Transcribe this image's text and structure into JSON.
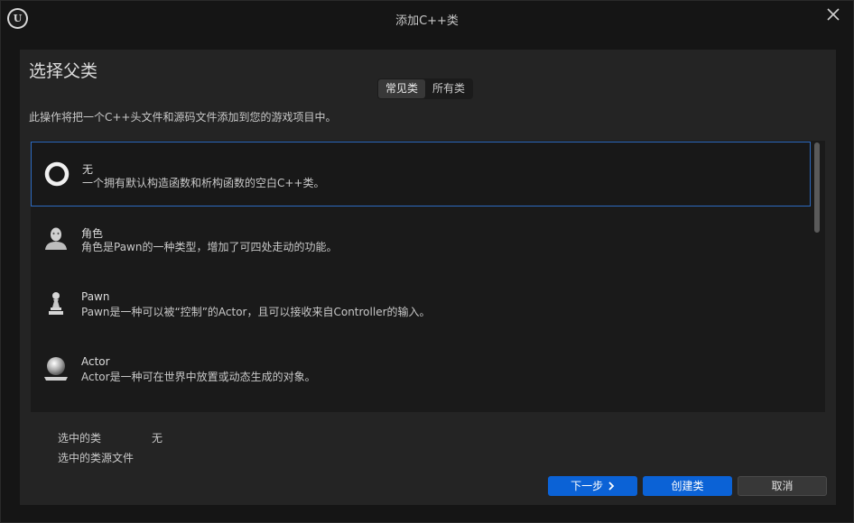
{
  "window": {
    "title": "添加C++类",
    "logo_text": "U"
  },
  "header": {
    "title": "选择父类"
  },
  "tabs": [
    {
      "label": "常见类",
      "active": true
    },
    {
      "label": "所有类",
      "active": false
    }
  ],
  "description": "此操作将把一个C++头文件和源码文件添加到您的游戏项目中。",
  "classes": [
    {
      "name": "无",
      "description": "一个拥有默认构造函数和析构函数的空白C++类。",
      "icon": "ring-icon",
      "selected": true
    },
    {
      "name": "角色",
      "description": "角色是Pawn的一种类型，增加了可四处走动的功能。",
      "icon": "character-icon",
      "selected": false
    },
    {
      "name": "Pawn",
      "description": "Pawn是一种可以被“控制”的Actor，且可以接收来自Controller的输入。",
      "icon": "pawn-icon",
      "selected": false
    },
    {
      "name": "Actor",
      "description": "Actor是一种可在世界中放置或动态生成的对象。",
      "icon": "actor-sphere-icon",
      "selected": false
    }
  ],
  "selection": {
    "class_label": "选中的类",
    "class_value": "无",
    "source_label": "选中的类源文件",
    "source_value": ""
  },
  "buttons": {
    "next": "下一步",
    "create": "创建类",
    "cancel": "取消"
  },
  "colors": {
    "accent": "#0b62d6",
    "selection_border": "#2d6ac0"
  }
}
